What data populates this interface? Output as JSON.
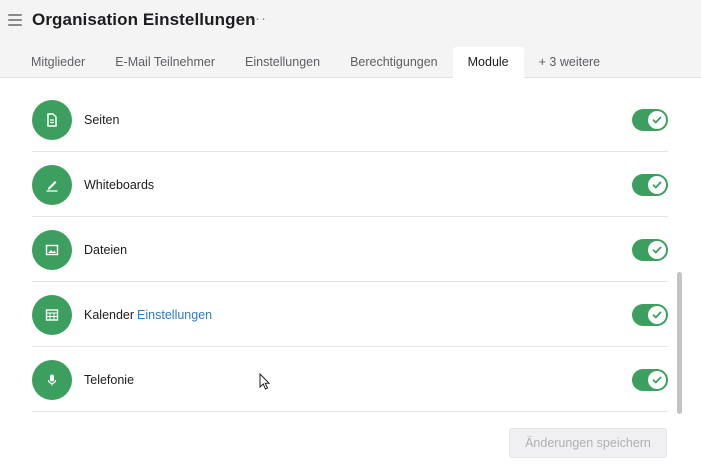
{
  "header": {
    "title": "Organisation Einstellungen",
    "more_glyph": "···",
    "tabs": [
      {
        "label": "Mitglieder",
        "active": false
      },
      {
        "label": "E-Mail Teilnehmer",
        "active": false
      },
      {
        "label": "Einstellungen",
        "active": false
      },
      {
        "label": "Berechtigungen",
        "active": false
      },
      {
        "label": "Module",
        "active": true
      },
      {
        "label": "+ 3 weitere",
        "active": false
      }
    ]
  },
  "modules": [
    {
      "label": "Seiten",
      "icon": "document-icon",
      "enabled": true
    },
    {
      "label": "Whiteboards",
      "icon": "pen-icon",
      "enabled": true
    },
    {
      "label": "Dateien",
      "icon": "image-icon",
      "enabled": true
    },
    {
      "label": "Kalender",
      "link": "Einstellungen",
      "icon": "calendar-icon",
      "enabled": true
    },
    {
      "label": "Telefonie",
      "icon": "microphone-icon",
      "enabled": true
    }
  ],
  "footer": {
    "save_label": "Änderungen speichern",
    "save_disabled": true
  },
  "colors": {
    "accent_green": "#3c9f5f",
    "link_blue": "#2f7bc4",
    "header_bg": "#f4f4f5"
  }
}
